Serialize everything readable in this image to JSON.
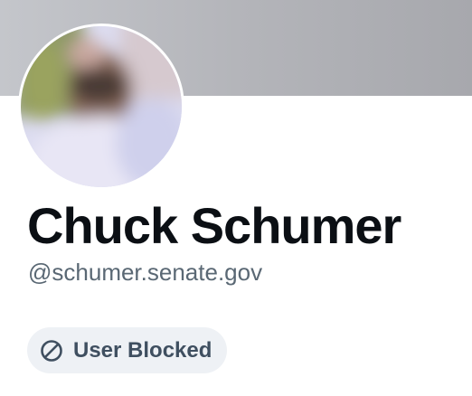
{
  "profile": {
    "display_name": "Chuck Schumer",
    "handle": "@schumer.senate.gov",
    "status_badge": {
      "label": "User Blocked",
      "icon": "blocked-icon"
    },
    "avatar_state": "blurred"
  },
  "colors": {
    "banner": "#b4b5ba",
    "name_text": "#0b0f14",
    "handle_text": "#5a6874",
    "badge_bg": "#eef1f5",
    "badge_text": "#3f4f60"
  }
}
